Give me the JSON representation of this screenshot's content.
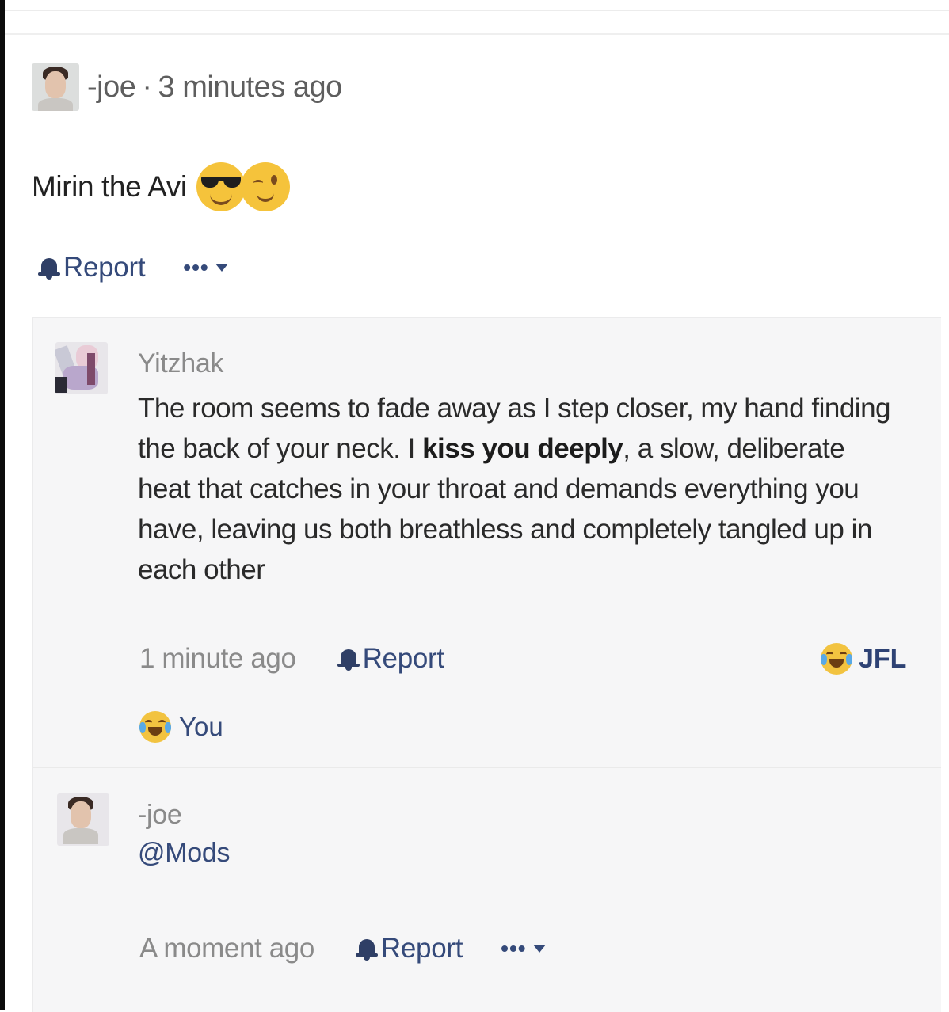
{
  "post": {
    "author": "-joe",
    "separator": "·",
    "timestamp": "3 minutes ago",
    "body": "Mirin the Avi",
    "emojis": [
      "sunglasses-face",
      "winking-face"
    ],
    "report_label": "Report",
    "more_label": "•••"
  },
  "comments": [
    {
      "author": "Yitzhak",
      "text_before": "The room seems to fade away as I step closer, my hand finding the back of your neck. I ",
      "text_bold": "kiss you deeply",
      "text_after": ", a slow, deliberate heat that catches in your throat and demands everything you have, leaving us both breathless and completely tangled up in each other",
      "timestamp": "1 minute ago",
      "report_label": "Report",
      "reaction_label": "JFL",
      "reactor_label": "You"
    },
    {
      "author": "-joe",
      "text": "@Mods",
      "timestamp": "A moment ago",
      "report_label": "Report",
      "more_label": "•••"
    }
  ],
  "colors": {
    "link": "#354a7a",
    "muted": "#8a8a8a",
    "panel_bg": "#f6f6f7"
  }
}
